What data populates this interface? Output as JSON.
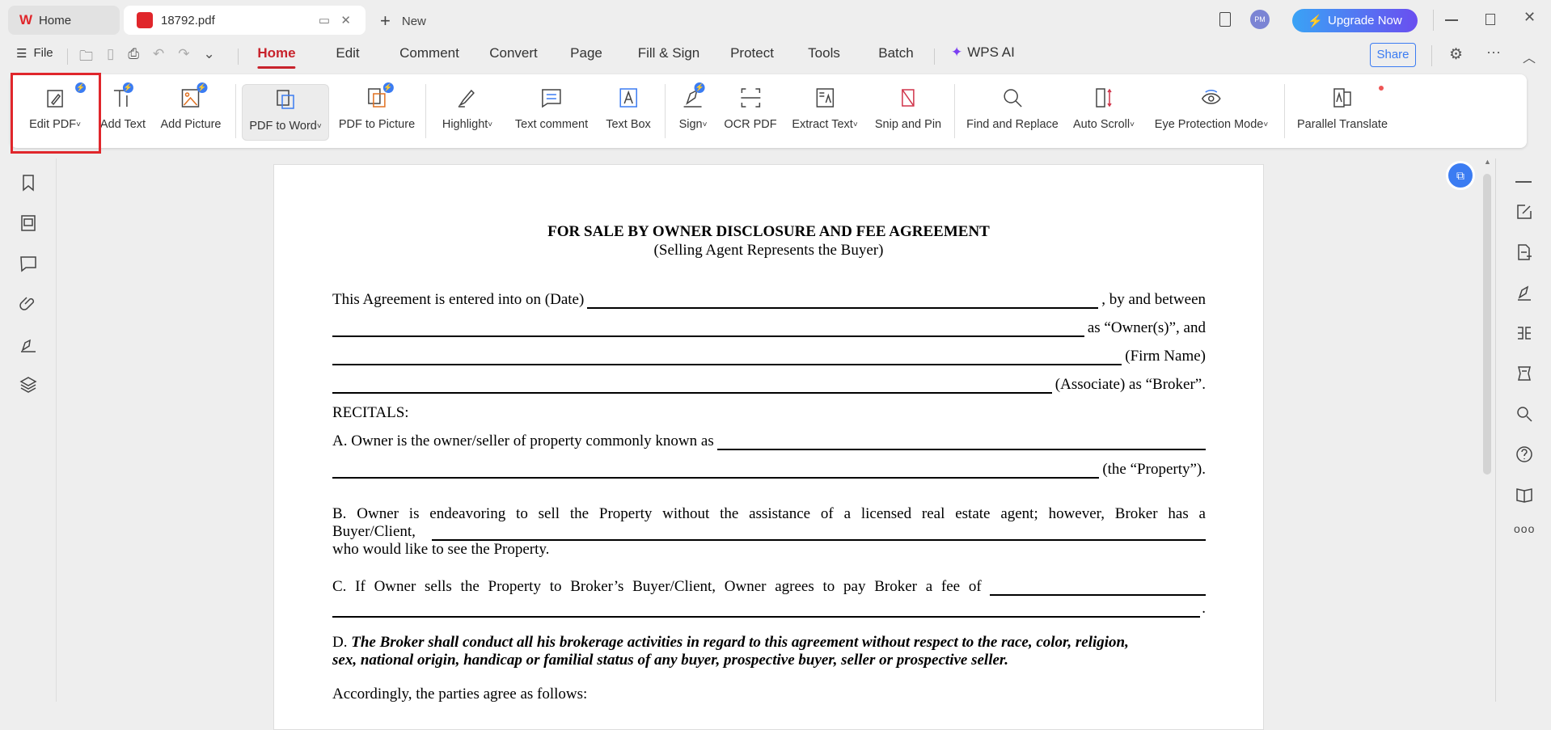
{
  "tabs": {
    "home": "Home",
    "file": "18792.pdf",
    "new": "New"
  },
  "titlebar": {
    "avatar": "PM",
    "upgrade": "Upgrade Now"
  },
  "menu": {
    "file": "File",
    "items": [
      "Home",
      "Edit",
      "Comment",
      "Convert",
      "Page",
      "Fill & Sign",
      "Protect",
      "Tools",
      "Batch"
    ],
    "wps_ai": "WPS AI",
    "share": "Share"
  },
  "ribbon": [
    "Edit PDF",
    "Add Text",
    "Add Picture",
    "PDF to Word",
    "PDF to Picture",
    "Highlight",
    "Text comment",
    "Text Box",
    "Sign",
    "OCR PDF",
    "Extract Text",
    "Snip and Pin",
    "Find and Replace",
    "Auto Scroll",
    "Eye Protection Mode",
    "Parallel Translate"
  ],
  "colors": {
    "accent": "#c8232c",
    "blue": "#3b7cf2",
    "highlight_box": "#e0262b"
  },
  "document": {
    "title": "FOR SALE BY OWNER DISCLOSURE AND FEE AGREEMENT",
    "subtitle": "(Selling Agent Represents the Buyer)",
    "l1a": "This Agreement is entered into on (Date)",
    "l1b": ", by and between",
    "l2": "as “Owner(s)”,  and",
    "l3": "(Firm Name)",
    "l4": "(Associate) as “Broker”.",
    "recitals": "RECITALS:",
    "a1": "A.  Owner is the owner/seller of property commonly known as",
    "a2": "(the “Property”).",
    "b1": "B.   Owner is endeavoring to sell the Property without the assistance of a licensed real estate agent; however, Broker has a",
    "b2": "Buyer/Client,",
    "b3": "who would like to see the Property.",
    "c1": "C.   If Owner sells the Property to Broker’s Buyer/Client, Owner agrees to pay Broker a fee of",
    "c2": ".",
    "d_label": "D.",
    "d1": "The Broker shall conduct all his brokerage activities in regard to this agreement without respect to the race, color, religion,",
    "d2": "sex, national origin, handicap or familial status of any buyer, prospective buyer, seller or prospective seller.",
    "acc": "Accordingly, the parties agree as follows:"
  }
}
